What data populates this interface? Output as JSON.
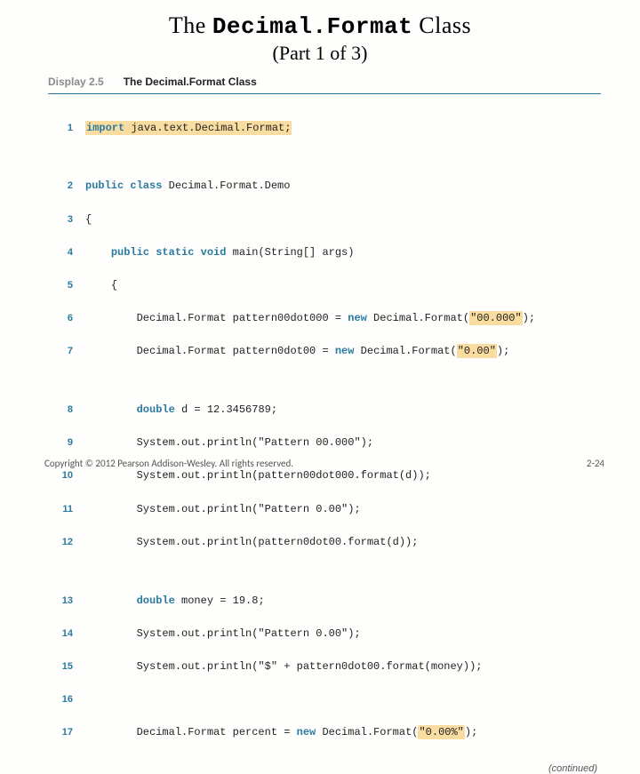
{
  "title_a": "The ",
  "title_b": "Decimal.Format",
  "title_c": " Class",
  "subtitle": "(Part 1 of 3)",
  "display_label": "Display 2.5",
  "display_title": "The Decimal.Format Class",
  "continued": "(continued)",
  "copyright": "Copyright © 2012 Pearson Addison-Wesley. All rights reserved.",
  "page_num": "2-24",
  "code": {
    "l1a": "import",
    "l1b": " java.text.Decimal.Format;",
    "l2a": "public class",
    "l2b": " Decimal.Format.Demo",
    "l3": "{",
    "l4a": "public static void",
    "l4b": " main(String[] args)",
    "l5": "{",
    "l6a": "Decimal.Format pattern00dot000 = ",
    "l6b": "new",
    "l6c": " Decimal.Format(",
    "l6d": "\"00.000\"",
    "l6e": ");",
    "l7a": "Decimal.Format pattern0dot00 = ",
    "l7b": "new",
    "l7c": " Decimal.Format(",
    "l7d": "\"0.00\"",
    "l7e": ");",
    "l8a": "double",
    "l8b": " d = 12.3456789;",
    "l9": "System.out.println(\"Pattern 00.000\");",
    "l10": "System.out.println(pattern00dot000.format(d));",
    "l11": "System.out.println(\"Pattern 0.00\");",
    "l12": "System.out.println(pattern0dot00.format(d));",
    "l13a": "double",
    "l13b": " money = 19.8;",
    "l14": "System.out.println(\"Pattern 0.00\");",
    "l15": "System.out.println(\"$\" + pattern0dot00.format(money));",
    "l17a": "Decimal.Format percent = ",
    "l17b": "new",
    "l17c": " Decimal.Format(",
    "l17d": "\"0.00%\"",
    "l17e": ");"
  },
  "ln": {
    "n1": "1",
    "n2": "2",
    "n3": "3",
    "n4": "4",
    "n5": "5",
    "n6": "6",
    "n7": "7",
    "n8": "8",
    "n9": "9",
    "n10": "10",
    "n11": "11",
    "n12": "12",
    "n13": "13",
    "n14": "14",
    "n15": "15",
    "n16": "16",
    "n17": "17"
  }
}
